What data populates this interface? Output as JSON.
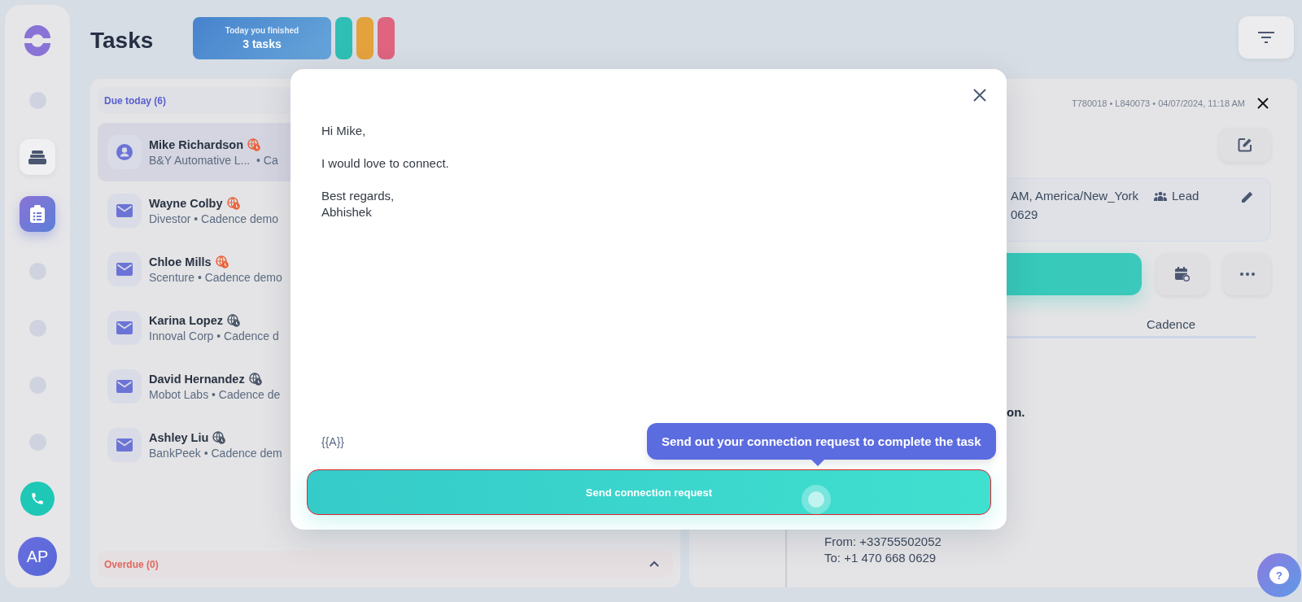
{
  "rail": {
    "items": [
      {
        "kind": "placeholder"
      },
      {
        "kind": "stack",
        "selected": false
      },
      {
        "kind": "tasks",
        "selected": true
      },
      {
        "kind": "placeholder"
      },
      {
        "kind": "placeholder"
      },
      {
        "kind": "placeholder"
      },
      {
        "kind": "placeholder"
      }
    ],
    "avatar": "AP"
  },
  "header": {
    "title": "Tasks",
    "stats": {
      "caption": "Today you finished",
      "value": "3 tasks"
    },
    "streaks": [
      {
        "color": "#2fbfb5"
      },
      {
        "color": "#e3a23c"
      },
      {
        "color": "#de6480"
      }
    ]
  },
  "task_list": {
    "section": "Due today (6)",
    "items": [
      {
        "kind": "person",
        "name": "Mike Richardson",
        "subtitle": "B&Y Automative L...  • Ca",
        "color": "#e8643c",
        "selected": true
      },
      {
        "kind": "mail",
        "name": "Wayne Colby",
        "subtitle": "Divestor • Cadence demo",
        "color": "#e8643c",
        "selected": false
      },
      {
        "kind": "mail",
        "name": "Chloe Mills",
        "subtitle": "Scenture • Cadence demo",
        "color": "#e8643c",
        "selected": false
      },
      {
        "kind": "mail",
        "name": "Karina Lopez",
        "subtitle": "Innoval Corp • Cadence d",
        "color": "#4a5568",
        "selected": false
      },
      {
        "kind": "mail",
        "name": "David Hernandez",
        "subtitle": "Mobot Labs • Cadence de",
        "color": "#4a5568",
        "selected": false
      },
      {
        "kind": "mail",
        "name": "Ashley Liu",
        "subtitle": "BankPeek • Cadence dem",
        "color": "#4a5568",
        "selected": false
      }
    ],
    "overdue": "Overdue (0)",
    "overdue_expanded": false
  },
  "detail": {
    "meta": "T780018 • L840073 • 04/07/2024, 11:18 AM",
    "info": {
      "timezone": "AM, America/New_York",
      "role": "Lead",
      "phone": "0629"
    },
    "tabs": [
      {
        "label": "Cadence",
        "selected": false
      }
    ],
    "note": "on.",
    "call": {
      "from": "From: +33755502052",
      "to": "To: +1 470 668 0629"
    }
  },
  "modal": {
    "message": [
      "Hi Mike,",
      "I would love to connect.",
      "Best regards,\nAbhishek"
    ],
    "variable": "{{A}}",
    "tooltip": "Send out your connection request to complete the task",
    "button": "Send connection request"
  },
  "help": {
    "label": "?"
  }
}
